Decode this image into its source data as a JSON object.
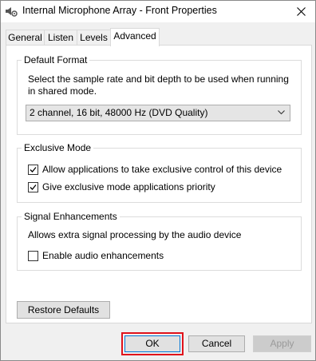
{
  "window": {
    "title": "Internal Microphone Array - Front Properties"
  },
  "tabs": [
    {
      "label": "General"
    },
    {
      "label": "Listen"
    },
    {
      "label": "Levels"
    },
    {
      "label": "Advanced",
      "active": true
    }
  ],
  "default_format": {
    "title": "Default Format",
    "description_line1": "Select the sample rate and bit depth to be used when running",
    "description_line2": "in shared mode.",
    "selected": "2 channel, 16 bit, 48000 Hz (DVD Quality)"
  },
  "exclusive_mode": {
    "title": "Exclusive Mode",
    "options": [
      {
        "label": "Allow applications to take exclusive control of this device",
        "checked": true
      },
      {
        "label": "Give exclusive mode applications priority",
        "checked": true
      }
    ]
  },
  "signal_enhancements": {
    "title": "Signal Enhancements",
    "description": "Allows extra signal processing by the audio device",
    "option": {
      "label": "Enable audio enhancements",
      "checked": false
    }
  },
  "buttons": {
    "restore": "Restore Defaults",
    "ok": "OK",
    "cancel": "Cancel",
    "apply": "Apply"
  },
  "colors": {
    "highlight": "#e0121b",
    "focus": "#0078d7"
  },
  "icons": {
    "title": "speaker-settings-icon",
    "close": "close-icon",
    "dropdown": "chevron-down-icon",
    "check": "checkmark-icon"
  }
}
